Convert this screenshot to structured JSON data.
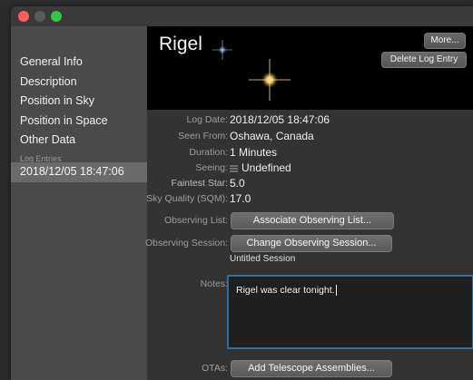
{
  "window": {
    "accent": "#2f6da3"
  },
  "sidebar": {
    "items": [
      {
        "label": "General Info"
      },
      {
        "label": "Description"
      },
      {
        "label": "Position in Sky"
      },
      {
        "label": "Position in Space"
      },
      {
        "label": "Other Data"
      }
    ],
    "section_label": "Log Entries",
    "selected_entry": "2018/12/05 18:47:06"
  },
  "header": {
    "object_name": "Rigel",
    "more_label": "More...",
    "delete_label": "Delete Log Entry"
  },
  "fields": {
    "log_date": {
      "label": "Log Date:",
      "value": "2018/12/05 18:47:06"
    },
    "seen_from": {
      "label": "Seen From:",
      "value": "Oshawa, Canada"
    },
    "duration": {
      "label": "Duration:",
      "value": "1 Minutes"
    },
    "seeing": {
      "label": "Seeing:",
      "value": "Undefined",
      "icon": "bars-icon"
    },
    "faintest_star": {
      "label": "Faintest Star:",
      "value": "5.0"
    },
    "sky_quality": {
      "label": "Sky Quality (SQM):",
      "value": "17.0"
    },
    "observing_list": {
      "label": "Observing List:",
      "button": "Associate Observing List..."
    },
    "observing_session": {
      "label": "Observing Session:",
      "button": "Change Observing Session...",
      "current": "Untitled Session"
    },
    "notes": {
      "label": "Notes:",
      "value": "Rigel was clear tonight."
    },
    "otas": {
      "label": "OTAs:",
      "button": "Add Telescope Assemblies..."
    }
  }
}
